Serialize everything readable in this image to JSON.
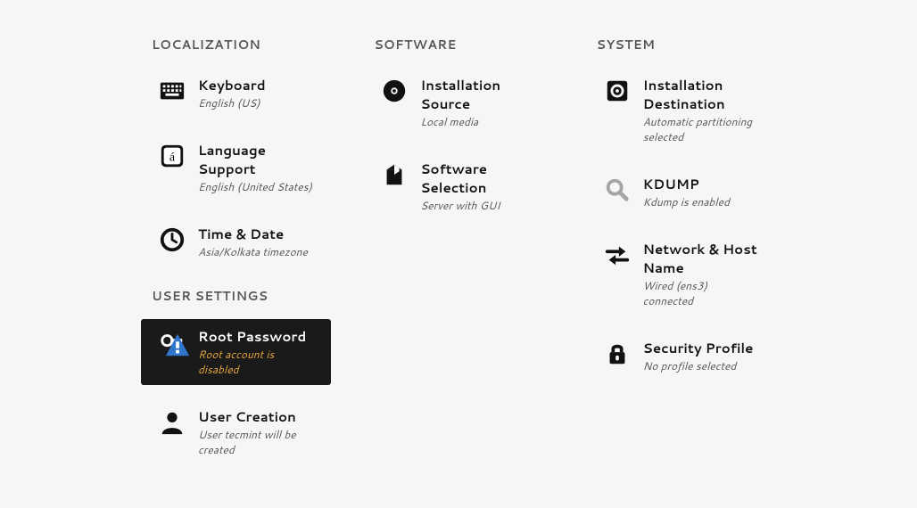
{
  "sections": {
    "localization": {
      "title": "LOCALIZATION",
      "keyboard": {
        "title": "Keyboard",
        "sub": "English (US)"
      },
      "language": {
        "title": "Language Support",
        "sub": "English (United States)"
      },
      "time": {
        "title": "Time & Date",
        "sub": "Asia/Kolkata timezone"
      }
    },
    "software": {
      "title": "SOFTWARE",
      "source": {
        "title": "Installation Source",
        "sub": "Local media"
      },
      "selection": {
        "title": "Software Selection",
        "sub": "Server with GUI"
      }
    },
    "system": {
      "title": "SYSTEM",
      "dest": {
        "title": "Installation Destination",
        "sub": "Automatic partitioning selected"
      },
      "kdump": {
        "title": "KDUMP",
        "sub": "Kdump is enabled"
      },
      "network": {
        "title": "Network & Host Name",
        "sub": "Wired (ens3) connected"
      },
      "security": {
        "title": "Security Profile",
        "sub": "No profile selected"
      }
    },
    "user": {
      "title": "USER SETTINGS",
      "root": {
        "title": "Root Password",
        "sub": "Root account is disabled"
      },
      "create": {
        "title": "User Creation",
        "sub": "User tecmint will be created"
      }
    }
  }
}
